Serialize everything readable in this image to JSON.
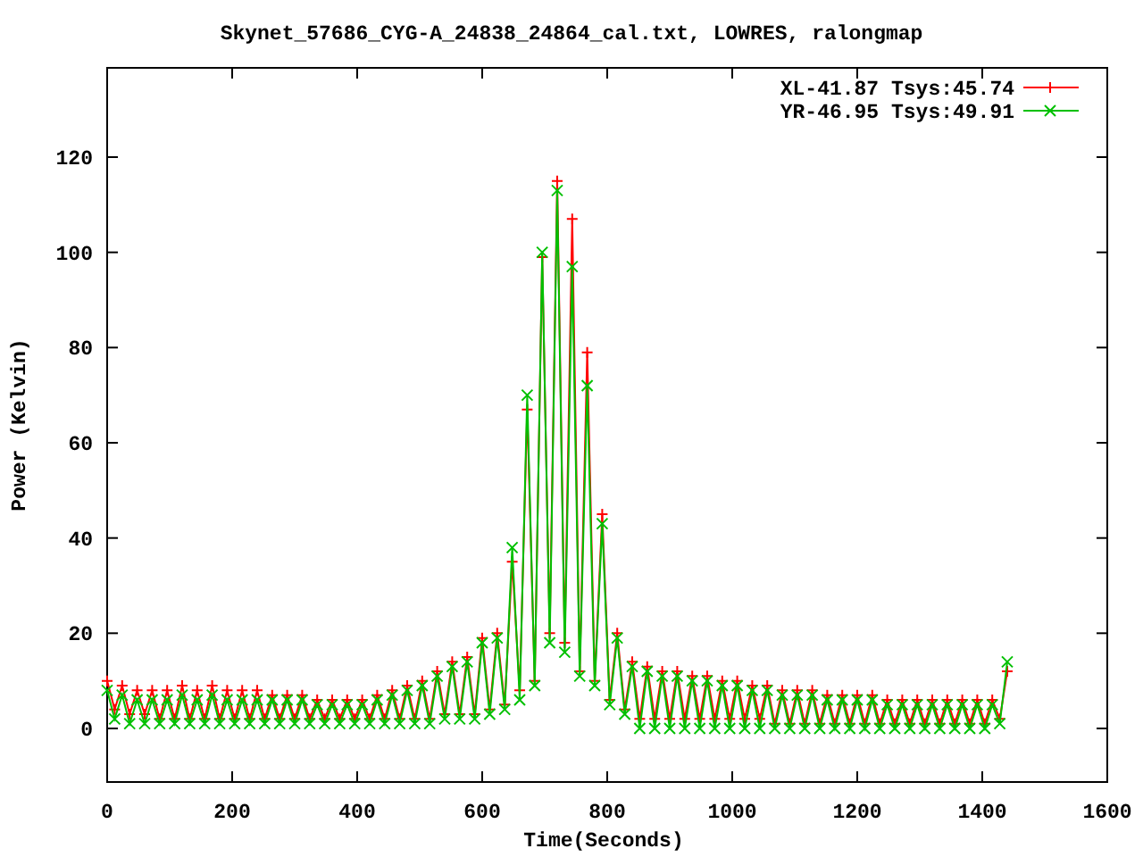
{
  "chart_data": {
    "type": "line",
    "title": "Skynet_57686_CYG-A_24838_24864_cal.txt, LOWRES, ralongmap",
    "xlabel": "Time(Seconds)",
    "ylabel": "Power (Kelvin)",
    "legend": true,
    "xlim": [
      0,
      1600
    ],
    "ylim": [
      -11.25,
      138.75
    ],
    "xticks": [
      0,
      200,
      400,
      600,
      800,
      1000,
      1200,
      1400,
      1600
    ],
    "yticks": [
      0,
      20,
      40,
      60,
      80,
      100,
      120
    ],
    "x": [
      0,
      12,
      24,
      36,
      48,
      60,
      72,
      84,
      96,
      108,
      120,
      132,
      144,
      156,
      168,
      180,
      192,
      204,
      216,
      228,
      240,
      252,
      264,
      276,
      288,
      300,
      312,
      324,
      336,
      348,
      360,
      372,
      384,
      396,
      408,
      420,
      432,
      444,
      456,
      468,
      480,
      492,
      504,
      516,
      528,
      540,
      552,
      564,
      576,
      588,
      600,
      612,
      624,
      636,
      648,
      660,
      672,
      684,
      696,
      708,
      720,
      732,
      744,
      756,
      768,
      780,
      792,
      804,
      816,
      828,
      840,
      852,
      864,
      876,
      888,
      900,
      912,
      924,
      936,
      948,
      960,
      972,
      984,
      996,
      1008,
      1020,
      1032,
      1044,
      1056,
      1068,
      1080,
      1092,
      1104,
      1116,
      1128,
      1140,
      1152,
      1164,
      1176,
      1188,
      1200,
      1212,
      1224,
      1236,
      1248,
      1260,
      1272,
      1284,
      1296,
      1308,
      1320,
      1332,
      1344,
      1356,
      1368,
      1380,
      1392,
      1404,
      1416,
      1428,
      1440
    ],
    "series": [
      {
        "name": "XL-41.87 Tsys:45.74",
        "color": "#ff0000",
        "marker": "plus",
        "values": [
          10,
          4,
          9,
          3,
          8,
          3,
          8,
          2,
          8,
          2,
          9,
          2,
          8,
          2,
          9,
          2,
          8,
          2,
          8,
          2,
          8,
          2,
          7,
          2,
          7,
          2,
          7,
          2,
          6,
          2,
          6,
          2,
          6,
          2,
          6,
          2,
          7,
          2,
          8,
          2,
          9,
          2,
          10,
          2,
          12,
          3,
          14,
          3,
          15,
          3,
          19,
          4,
          20,
          5,
          35,
          8,
          67,
          10,
          99,
          20,
          115,
          18,
          107,
          12,
          79,
          10,
          45,
          6,
          20,
          4,
          14,
          2,
          13,
          2,
          12,
          2,
          12,
          2,
          11,
          2,
          11,
          2,
          10,
          2,
          10,
          2,
          9,
          2,
          9,
          1,
          8,
          1,
          8,
          1,
          8,
          1,
          7,
          1,
          7,
          1,
          7,
          1,
          7,
          1,
          6,
          1,
          6,
          1,
          6,
          1,
          6,
          1,
          6,
          1,
          6,
          1,
          6,
          1,
          6,
          2,
          12
        ]
      },
      {
        "name": "YR-46.95 Tsys:49.91",
        "color": "#00c000",
        "marker": "cross",
        "values": [
          8,
          2,
          7,
          1,
          6,
          1,
          6,
          1,
          6,
          1,
          7,
          1,
          6,
          1,
          7,
          1,
          6,
          1,
          6,
          1,
          6,
          1,
          6,
          1,
          6,
          1,
          6,
          1,
          5,
          1,
          5,
          1,
          5,
          1,
          5,
          1,
          6,
          1,
          7,
          1,
          8,
          1,
          9,
          1,
          11,
          2,
          13,
          2,
          14,
          2,
          18,
          3,
          19,
          4,
          38,
          6,
          70,
          9,
          100,
          18,
          113,
          16,
          97,
          11,
          72,
          9,
          43,
          5,
          19,
          3,
          13,
          0,
          12,
          0,
          11,
          0,
          11,
          0,
          10,
          0,
          10,
          0,
          9,
          0,
          9,
          0,
          8,
          0,
          8,
          0,
          7,
          0,
          7,
          0,
          7,
          0,
          6,
          0,
          6,
          0,
          6,
          0,
          6,
          0,
          5,
          0,
          5,
          0,
          5,
          0,
          5,
          0,
          5,
          0,
          5,
          0,
          5,
          0,
          5,
          1,
          14
        ]
      }
    ]
  }
}
